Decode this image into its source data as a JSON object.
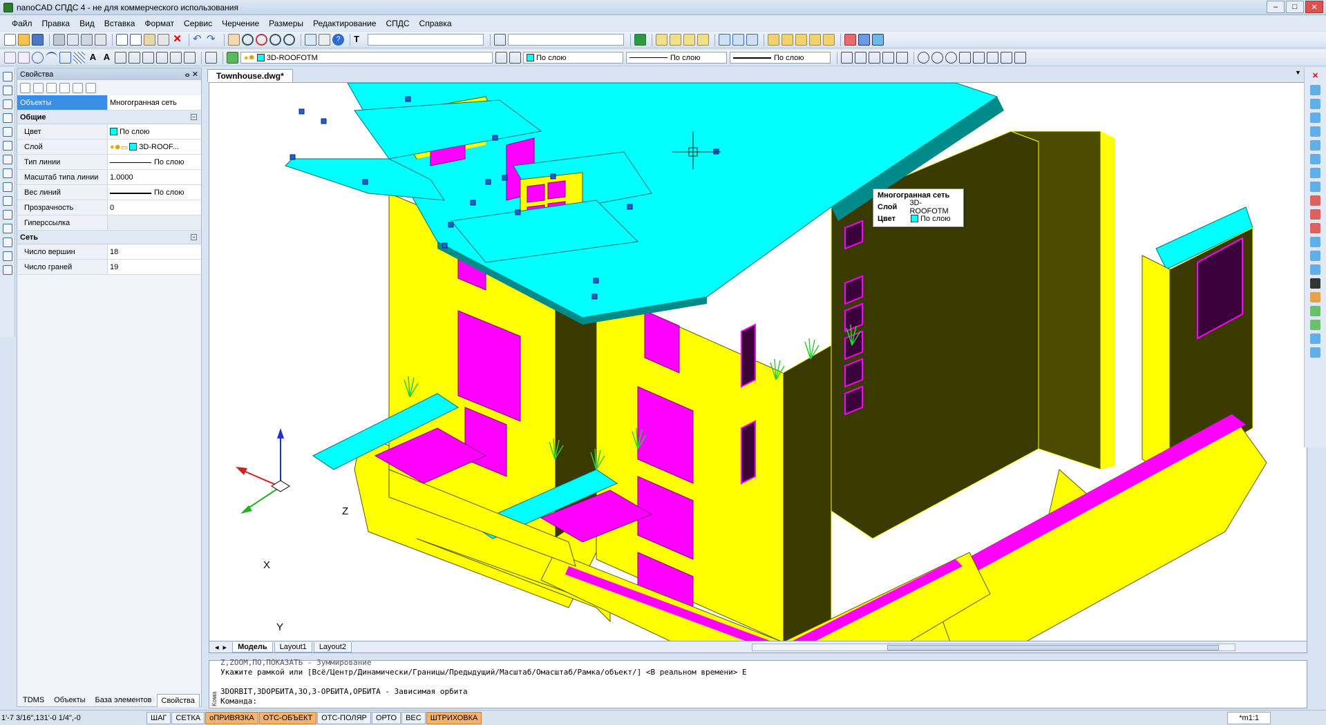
{
  "window": {
    "title": "nanoCAD СПДС 4 - не для коммерческого использования"
  },
  "menu": [
    "Файл",
    "Правка",
    "Вид",
    "Вставка",
    "Формат",
    "Сервис",
    "Черчение",
    "Размеры",
    "Редактирование",
    "СПДС",
    "Справка"
  ],
  "toolbar": {
    "layer_combo": "3D-ROOFOTM",
    "color_combo": "По слою",
    "linetype_combo": "По слою",
    "lineweight_combo": "По слою"
  },
  "properties": {
    "title": "Свойства",
    "object_key": "Объекты",
    "object_value": "Многогранная сеть",
    "groups": [
      {
        "name": "Общие",
        "rows": [
          {
            "key": "Цвет",
            "value": "По слою"
          },
          {
            "key": "Слой",
            "value": "3D-ROOF..."
          },
          {
            "key": "Тип линии",
            "value": "По слою"
          },
          {
            "key": "Масштаб типа линии",
            "value": "1.0000"
          },
          {
            "key": "Вес линий",
            "value": "По слою"
          },
          {
            "key": "Прозрачность",
            "value": "0"
          },
          {
            "key": "Гиперссылка",
            "value": ""
          }
        ]
      },
      {
        "name": "Сеть",
        "rows": [
          {
            "key": "Число вершин",
            "value": "18"
          },
          {
            "key": "Число граней",
            "value": "19"
          }
        ]
      }
    ]
  },
  "panel_tabs": [
    "TDMS",
    "Объекты",
    "База элементов",
    "Свойства"
  ],
  "document_tab": "Townhouse.dwg*",
  "tooltip": {
    "title": "Многогранная сеть",
    "layer_label": "Слой",
    "layer_value": "3D-ROOFOTM",
    "color_label": "Цвет",
    "color_value": "По слою"
  },
  "ucs": {
    "x": "X",
    "y": "Y",
    "z": "Z"
  },
  "layout_tabs": [
    "Модель",
    "Layout1",
    "Layout2"
  ],
  "command_lines": [
    "Z,ZOOM,ПО,ПОКАЗАТЬ - Зуммирование",
    "Укажите рамкой или [Всё/Центр/Динамически/Границы/Предыдущий/Масштаб/Омасштаб/Рамка/объект/] <В реальном времени> E",
    "",
    "3DORBIT,3DОРБИТА,3О,3-ОРБИТА,ОРБИТА - Зависимая орбита",
    "Команда:"
  ],
  "command_label": "Кома",
  "status": {
    "coords": "1'-7 3/16\",131'-0 1/4\",-0",
    "buttons": [
      {
        "label": "ШАГ",
        "on": false
      },
      {
        "label": "СЕТКА",
        "on": false
      },
      {
        "label": "оПРИВЯЗКА",
        "on": true
      },
      {
        "label": "ОТС-ОБЪЕКТ",
        "on": true
      },
      {
        "label": "ОТС-ПОЛЯР",
        "on": false
      },
      {
        "label": "ОРТО",
        "on": false
      },
      {
        "label": "ВЕС",
        "on": false
      },
      {
        "label": "ШТРИХОВКА",
        "on": true
      }
    ],
    "scale": "*m1:1"
  },
  "colors": {
    "roof": "#00ffff",
    "wall": "#ffff00",
    "window": "#ff00ff",
    "shadow": "#3a3a00",
    "plant": "#33cc33",
    "grip": "#1f5fd6"
  }
}
